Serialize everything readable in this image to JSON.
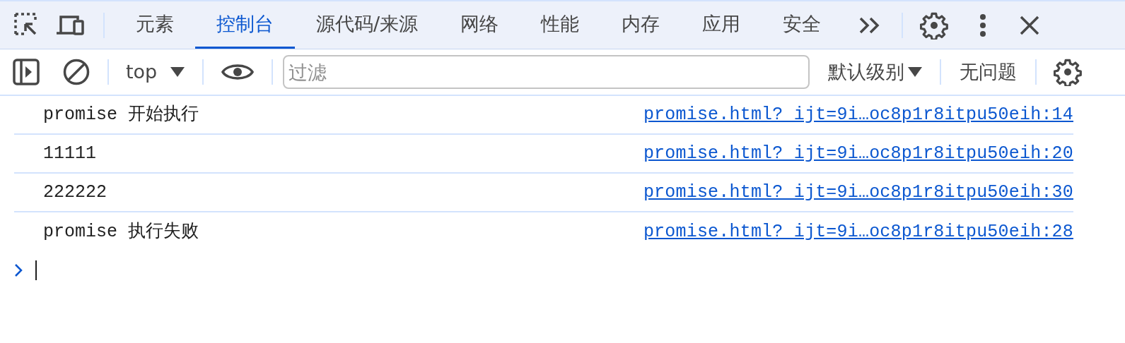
{
  "tabs": [
    {
      "label": "元素",
      "selected": false
    },
    {
      "label": "控制台",
      "selected": true
    },
    {
      "label": "源代码/来源",
      "selected": false
    },
    {
      "label": "网络",
      "selected": false
    },
    {
      "label": "性能",
      "selected": false
    },
    {
      "label": "内存",
      "selected": false
    },
    {
      "label": "应用",
      "selected": false
    },
    {
      "label": "安全",
      "selected": false
    }
  ],
  "console_toolbar": {
    "context": "top",
    "filter": {
      "placeholder": "过滤"
    },
    "levels": "默认级别",
    "issues": "无问题"
  },
  "messages": [
    {
      "text": "promise 开始执行",
      "source": "promise.html?_ijt=9i…oc8p1r8itpu50eih:14"
    },
    {
      "text": "11111",
      "source": "promise.html?_ijt=9i…oc8p1r8itpu50eih:20"
    },
    {
      "text": "222222",
      "source": "promise.html?_ijt=9i…oc8p1r8itpu50eih:30"
    },
    {
      "text": "promise 执行失败",
      "source": "promise.html?_ijt=9i…oc8p1r8itpu50eih:28"
    }
  ]
}
